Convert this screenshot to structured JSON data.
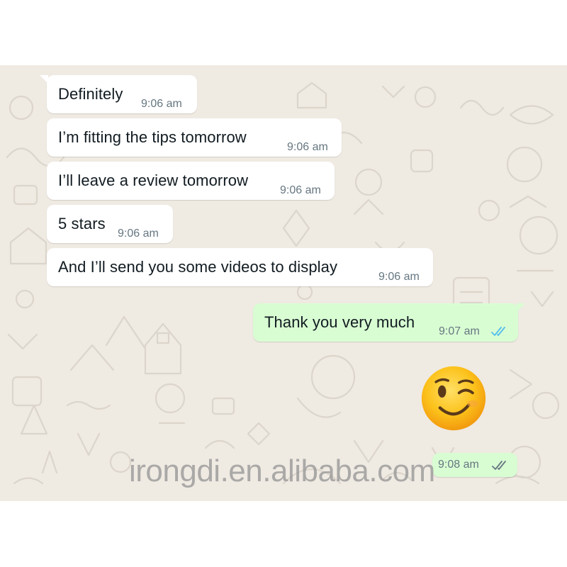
{
  "colors": {
    "wallpaper": "#efeae2",
    "incoming_bubble": "#ffffff",
    "outgoing_bubble": "#d9fdd3",
    "text": "#111b21",
    "timestamp": "#667781",
    "read_tick": "#53bdeb",
    "delivered_tick": "#667781"
  },
  "messages": [
    {
      "text": "Definitely",
      "time": "9:06 am",
      "direction": "incoming"
    },
    {
      "text": "I’m fitting the tips tomorrow",
      "time": "9:06 am",
      "direction": "incoming"
    },
    {
      "text": "I’ll leave a review tomorrow",
      "time": "9:06 am",
      "direction": "incoming"
    },
    {
      "text": "5 stars",
      "time": "9:06 am",
      "direction": "incoming"
    },
    {
      "text": "And I’ll send you some videos to display",
      "time": "9:06 am",
      "direction": "incoming"
    },
    {
      "text": "Thank you very much",
      "time": "9:07 am",
      "direction": "outgoing",
      "status": "read"
    },
    {
      "emoji": "winking-face",
      "time": "9:08 am",
      "direction": "outgoing",
      "status": "delivered"
    }
  ],
  "watermark": "irongdi.en.alibaba.com"
}
